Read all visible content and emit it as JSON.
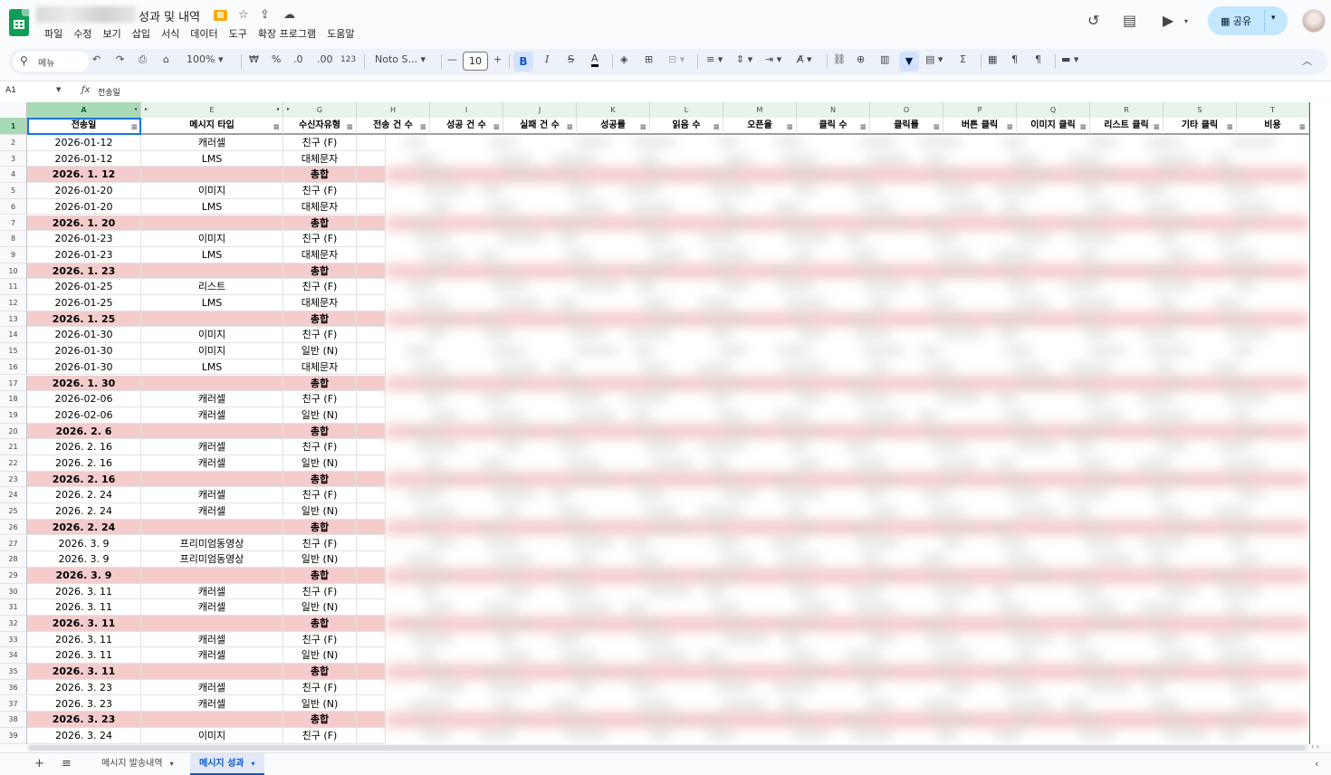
{
  "title": {
    "doc_name": "성과 및 내역"
  },
  "menu": [
    "파일",
    "수정",
    "보기",
    "삽입",
    "서식",
    "데이터",
    "도구",
    "확장 프로그램",
    "도움말"
  ],
  "header_right": {
    "share_label": "공유"
  },
  "toolbar": {
    "search_placeholder": "메뉴",
    "zoom": "100%",
    "currency": "₩",
    "percent": "%",
    "dec_decrease": ".0",
    "dec_increase": ".00",
    "number_format": "123",
    "font": "Noto S...",
    "font_size": "10",
    "minus": "—",
    "plus": "+",
    "bold": "B",
    "italic": "I",
    "strike": "S",
    "text_color": "A"
  },
  "formula_bar": {
    "name_box": "A1",
    "content": "전송일"
  },
  "columns": [
    "A",
    "E",
    "G",
    "H",
    "I",
    "J",
    "K",
    "L",
    "M",
    "N",
    "O",
    "P",
    "Q",
    "R",
    "S",
    "T"
  ],
  "header_labels": [
    "전송일",
    "메시지 타입",
    "수신자유형",
    "전송 건 수",
    "성공 건 수",
    "실패 건 수",
    "성공률",
    "읽음 수",
    "오픈율",
    "클릭 수",
    "클릭률",
    "버튼 클릭",
    "이미지 클릭",
    "리스트 클릭",
    "기타 클릭",
    "비용"
  ],
  "rows": [
    {
      "n": "2",
      "date": "2026-01-12",
      "type": "캐러셀",
      "recv": "친구 (F)",
      "total": false
    },
    {
      "n": "3",
      "date": "2026-01-12",
      "type": "LMS",
      "recv": "대체문자",
      "total": false
    },
    {
      "n": "4",
      "date": "2026. 1. 12",
      "type": "",
      "recv": "총합",
      "total": true
    },
    {
      "n": "5",
      "date": "2026-01-20",
      "type": "이미지",
      "recv": "친구 (F)",
      "total": false
    },
    {
      "n": "6",
      "date": "2026-01-20",
      "type": "LMS",
      "recv": "대체문자",
      "total": false
    },
    {
      "n": "7",
      "date": "2026. 1. 20",
      "type": "",
      "recv": "총합",
      "total": true
    },
    {
      "n": "8",
      "date": "2026-01-23",
      "type": "이미지",
      "recv": "친구 (F)",
      "total": false
    },
    {
      "n": "9",
      "date": "2026-01-23",
      "type": "LMS",
      "recv": "대체문자",
      "total": false
    },
    {
      "n": "10",
      "date": "2026. 1. 23",
      "type": "",
      "recv": "총합",
      "total": true
    },
    {
      "n": "11",
      "date": "2026-01-25",
      "type": "리스트",
      "recv": "친구 (F)",
      "total": false
    },
    {
      "n": "12",
      "date": "2026-01-25",
      "type": "LMS",
      "recv": "대체문자",
      "total": false
    },
    {
      "n": "13",
      "date": "2026. 1. 25",
      "type": "",
      "recv": "총합",
      "total": true
    },
    {
      "n": "14",
      "date": "2026-01-30",
      "type": "이미지",
      "recv": "친구 (F)",
      "total": false
    },
    {
      "n": "15",
      "date": "2026-01-30",
      "type": "이미지",
      "recv": "일반 (N)",
      "total": false
    },
    {
      "n": "16",
      "date": "2026-01-30",
      "type": "LMS",
      "recv": "대체문자",
      "total": false
    },
    {
      "n": "17",
      "date": "2026. 1. 30",
      "type": "",
      "recv": "총합",
      "total": true
    },
    {
      "n": "18",
      "date": "2026-02-06",
      "type": "캐러셀",
      "recv": "친구 (F)",
      "total": false
    },
    {
      "n": "19",
      "date": "2026-02-06",
      "type": "캐러셀",
      "recv": "일반 (N)",
      "total": false
    },
    {
      "n": "20",
      "date": "2026. 2. 6",
      "type": "",
      "recv": "총합",
      "total": true
    },
    {
      "n": "21",
      "date": "2026. 2. 16",
      "type": "캐러셀",
      "recv": "친구 (F)",
      "total": false
    },
    {
      "n": "22",
      "date": "2026. 2. 16",
      "type": "캐러셀",
      "recv": "일반 (N)",
      "total": false
    },
    {
      "n": "23",
      "date": "2026. 2. 16",
      "type": "",
      "recv": "총합",
      "total": true
    },
    {
      "n": "24",
      "date": "2026. 2. 24",
      "type": "캐러셀",
      "recv": "친구 (F)",
      "total": false
    },
    {
      "n": "25",
      "date": "2026. 2. 24",
      "type": "캐러셀",
      "recv": "일반 (N)",
      "total": false
    },
    {
      "n": "26",
      "date": "2026. 2. 24",
      "type": "",
      "recv": "총합",
      "total": true
    },
    {
      "n": "27",
      "date": "2026. 3. 9",
      "type": "프리미엄동영상",
      "recv": "친구 (F)",
      "total": false
    },
    {
      "n": "28",
      "date": "2026. 3. 9",
      "type": "프리미엄동영상",
      "recv": "일반 (N)",
      "total": false
    },
    {
      "n": "29",
      "date": "2026. 3. 9",
      "type": "",
      "recv": "총합",
      "total": true
    },
    {
      "n": "30",
      "date": "2026. 3. 11",
      "type": "캐러셀",
      "recv": "친구 (F)",
      "total": false
    },
    {
      "n": "31",
      "date": "2026. 3. 11",
      "type": "캐러셀",
      "recv": "일반 (N)",
      "total": false
    },
    {
      "n": "32",
      "date": "2026. 3. 11",
      "type": "",
      "recv": "총합",
      "total": true
    },
    {
      "n": "33",
      "date": "2026. 3. 11",
      "type": "캐러셀",
      "recv": "친구 (F)",
      "total": false
    },
    {
      "n": "34",
      "date": "2026. 3. 11",
      "type": "캐러셀",
      "recv": "일반 (N)",
      "total": false
    },
    {
      "n": "35",
      "date": "2026. 3. 11",
      "type": "",
      "recv": "총합",
      "total": true
    },
    {
      "n": "36",
      "date": "2026. 3. 23",
      "type": "캐러셀",
      "recv": "친구 (F)",
      "total": false
    },
    {
      "n": "37",
      "date": "2026. 3. 23",
      "type": "캐러셀",
      "recv": "일반 (N)",
      "total": false
    },
    {
      "n": "38",
      "date": "2026. 3. 23",
      "type": "",
      "recv": "총합",
      "total": true
    },
    {
      "n": "39",
      "date": "2026. 3. 24",
      "type": "이미지",
      "recv": "친구 (F)",
      "total": false
    }
  ],
  "sheets": [
    {
      "label": "메시지 발송내역",
      "active": false
    },
    {
      "label": "메시지 성과",
      "active": true
    }
  ],
  "colors": {
    "total_row": "#f4cccc",
    "selected_header": "#a8dab5",
    "share_button": "#c2e7ff",
    "accent": "#0b57d0"
  }
}
